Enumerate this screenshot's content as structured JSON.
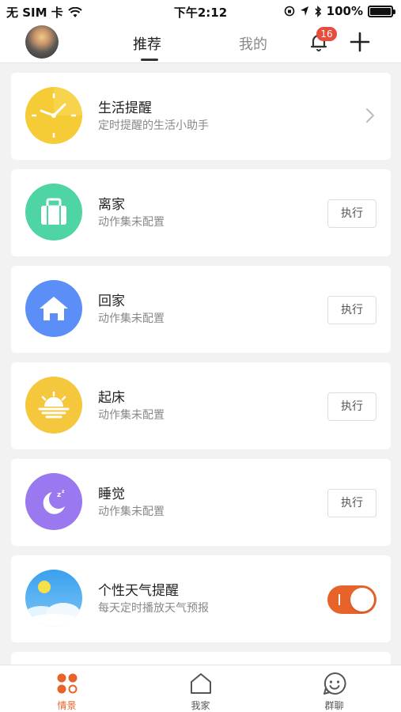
{
  "status_bar": {
    "carrier": "无 SIM 卡",
    "time": "下午2:12",
    "battery": "100%"
  },
  "nav": {
    "tabs": [
      {
        "label": "推荐",
        "active": true
      },
      {
        "label": "我的",
        "active": false
      }
    ],
    "notification_count": "16"
  },
  "cards": [
    {
      "title": "生活提醒",
      "subtitle": "定时提醒的生活小助手",
      "icon": "clock-icon",
      "color": "#f5cc36",
      "action": "chevron"
    },
    {
      "title": "离家",
      "subtitle": "动作集未配置",
      "icon": "suitcase-icon",
      "color": "#4fd4a3",
      "action": "执行"
    },
    {
      "title": "回家",
      "subtitle": "动作集未配置",
      "icon": "house-icon",
      "color": "#5b8ff7",
      "action": "执行"
    },
    {
      "title": "起床",
      "subtitle": "动作集未配置",
      "icon": "sunrise-icon",
      "color": "#f5c73c",
      "action": "执行"
    },
    {
      "title": "睡觉",
      "subtitle": "动作集未配置",
      "icon": "moon-icon",
      "color": "#9a78f0",
      "action": "执行"
    },
    {
      "title": "个性天气提醒",
      "subtitle": "每天定时播放天气预报",
      "icon": "weather-icon",
      "color": "#47a9f0",
      "action": "toggle-on"
    }
  ],
  "tab_bar": {
    "items": [
      {
        "label": "情景",
        "icon": "scenes-icon",
        "active": true
      },
      {
        "label": "我家",
        "icon": "home-icon",
        "active": false
      },
      {
        "label": "群聊",
        "icon": "smiley-chat-icon",
        "active": false
      }
    ]
  },
  "colors": {
    "accent": "#e8632a",
    "badge": "#e74c3c",
    "background": "#f2f2f2"
  }
}
